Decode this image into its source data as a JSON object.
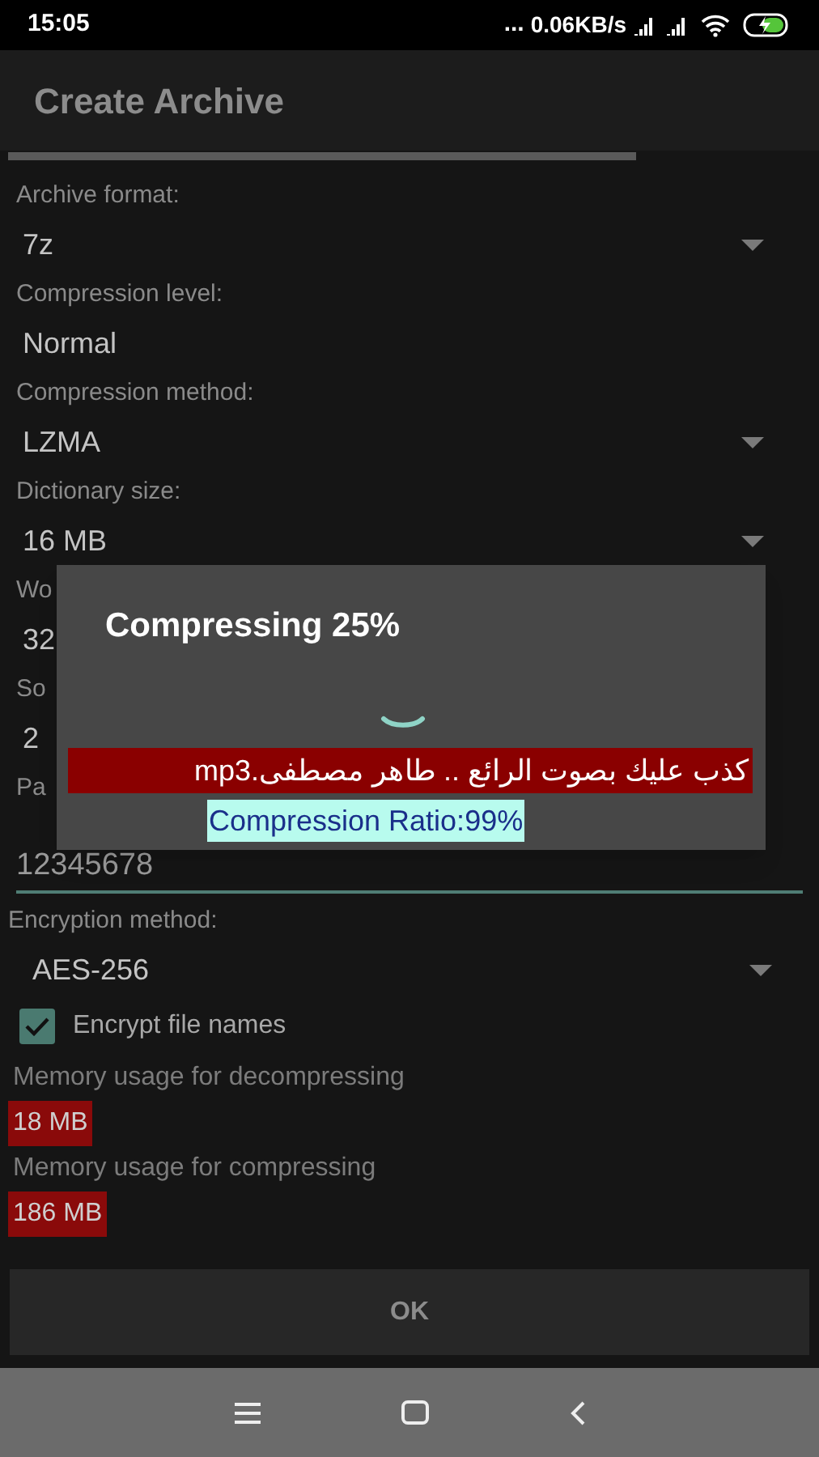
{
  "status_bar": {
    "time": "15:05",
    "dots": "...",
    "speed": "0.06KB/s"
  },
  "app_bar": {
    "title": "Create Archive"
  },
  "fields": [
    {
      "label": "Archive format:",
      "value": "7z",
      "dropdown": true
    },
    {
      "label": "Compression level:",
      "value": "Normal",
      "dropdown": false
    },
    {
      "label": "Compression method:",
      "value": "LZMA",
      "dropdown": true
    },
    {
      "label": "Dictionary size:",
      "value": "16 MB",
      "dropdown": true
    },
    {
      "label": "Wo",
      "value": "32"
    },
    {
      "label": "So",
      "value": "2"
    }
  ],
  "password": {
    "label": "Pa",
    "value": "12345678"
  },
  "encryption": {
    "label": "Encryption method:",
    "value": "AES-256",
    "dropdown": true
  },
  "encrypt_names": {
    "label": "Encrypt file names",
    "checked": true
  },
  "memory": [
    {
      "label": "Memory usage for decompressing",
      "value": "18 MB"
    },
    {
      "label": "Memory usage for compressing",
      "value": "186 MB"
    }
  ],
  "ok_button": "OK",
  "dialog": {
    "title": "Compressing 25%",
    "file": "كذب عليك بصوت الرائع .. طاهر مصطفى.mp3",
    "ratio": "Compression Ratio:99%"
  }
}
